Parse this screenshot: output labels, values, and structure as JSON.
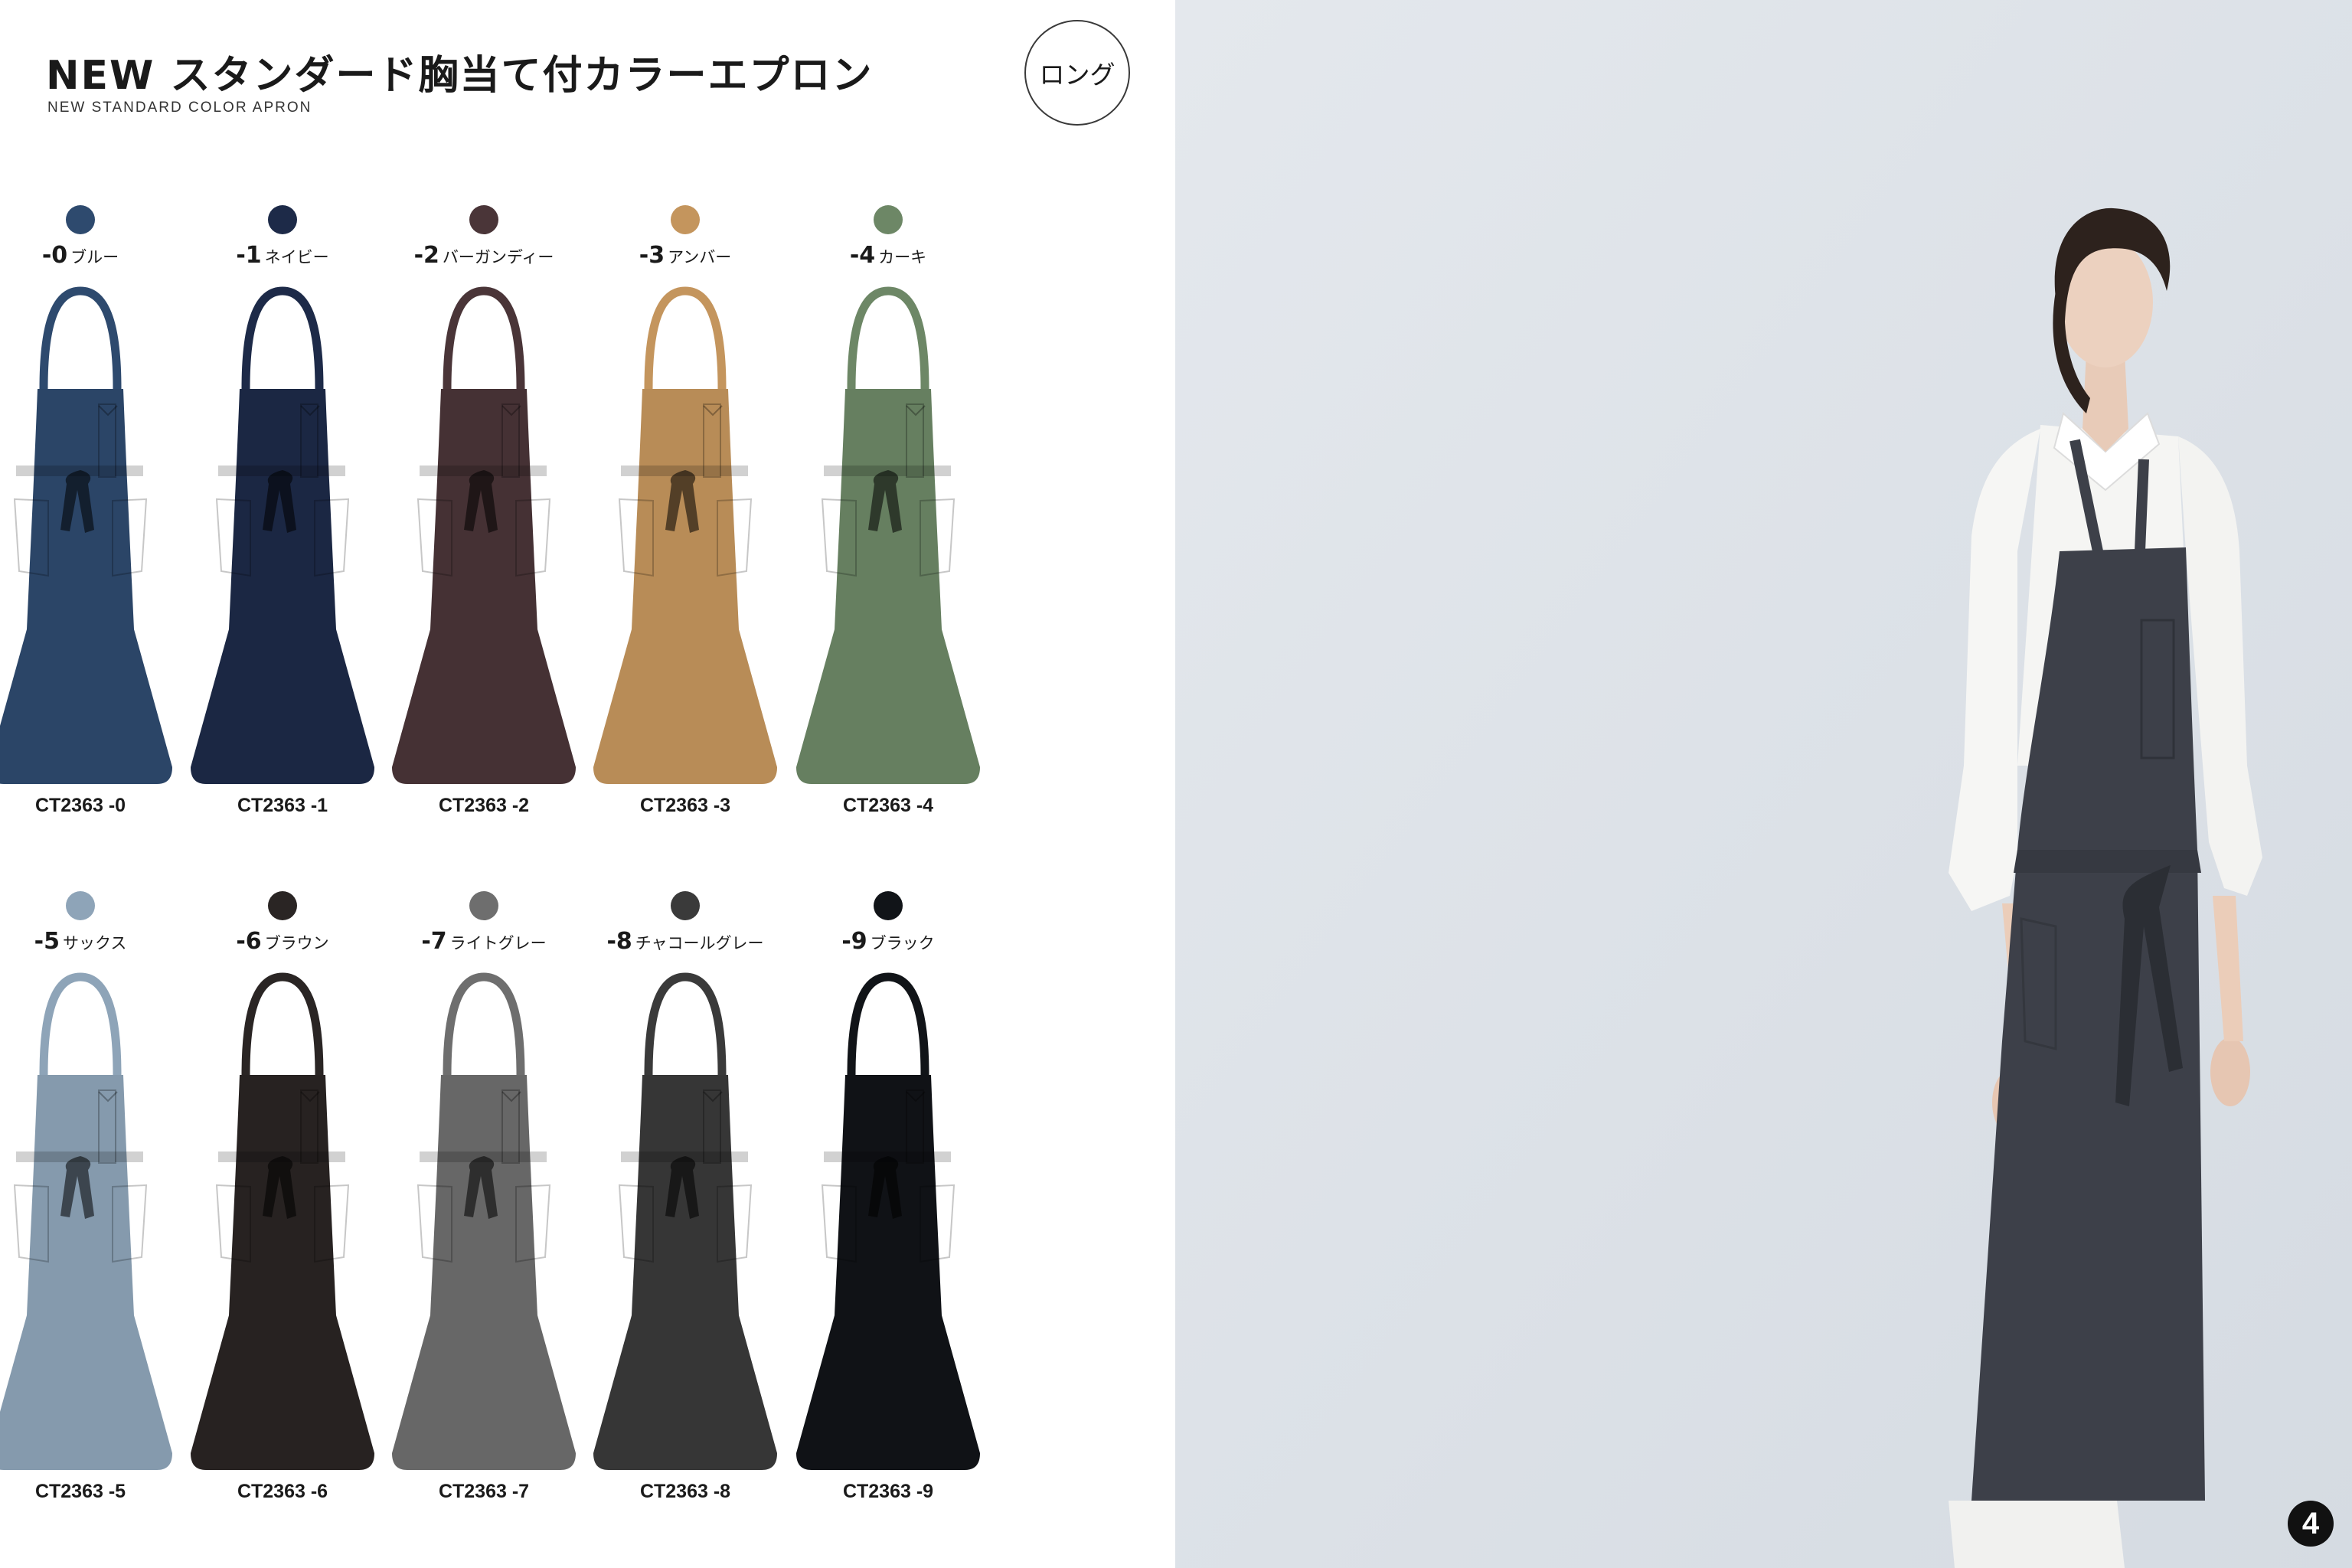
{
  "header": {
    "title": "NEW スタンダード胸当て付カラーエプロン",
    "subtitle": "NEW STANDARD COLOR APRON",
    "length_badge": "ロング"
  },
  "variants": [
    {
      "num": "-0",
      "name": "ブルー",
      "code": "CT2363 -0",
      "color": "#2e4a6e"
    },
    {
      "num": "-1",
      "name": "ネイビー",
      "code": "CT2363 -1",
      "color": "#1d2a48"
    },
    {
      "num": "-2",
      "name": "バーガンディー",
      "code": "CT2363 -2",
      "color": "#4a3538"
    },
    {
      "num": "-3",
      "name": "アンバー",
      "code": "CT2363 -3",
      "color": "#c4955d"
    },
    {
      "num": "-4",
      "name": "カーキ",
      "code": "CT2363 -4",
      "color": "#6d8766"
    },
    {
      "num": "-5",
      "name": "サックス",
      "code": "CT2363 -5",
      "color": "#8ea4b8"
    },
    {
      "num": "-6",
      "name": "ブラウン",
      "code": "CT2363 -6",
      "color": "#2a2524"
    },
    {
      "num": "-7",
      "name": "ライトグレー",
      "code": "CT2363 -7",
      "color": "#6e6e6e"
    },
    {
      "num": "-8",
      "name": "チャコールグレー",
      "code": "CT2363 -8",
      "color": "#3a3a3a"
    },
    {
      "num": "-9",
      "name": "ブラック",
      "code": "CT2363 -9",
      "color": "#111418"
    }
  ],
  "photo": {
    "apron_color": "#3d4049",
    "background_color": "#dfe4ea"
  },
  "page_number": "4"
}
